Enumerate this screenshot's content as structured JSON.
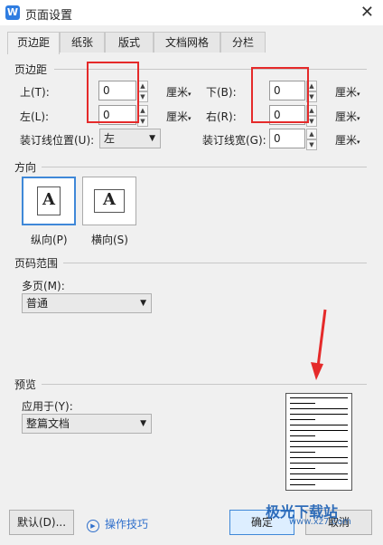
{
  "window": {
    "title": "页面设置",
    "close_glyph": "✕",
    "app_icon": "W"
  },
  "tabs": [
    "页边距",
    "纸张",
    "版式",
    "文档网格",
    "分栏"
  ],
  "margins": {
    "section": "页边距",
    "top": {
      "label": "上(T):",
      "value": "0",
      "unit": "厘米"
    },
    "bottom": {
      "label": "下(B):",
      "value": "0",
      "unit": "厘米"
    },
    "left": {
      "label": "左(L):",
      "value": "0",
      "unit": "厘米"
    },
    "right": {
      "label": "右(R):",
      "value": "0",
      "unit": "厘米"
    },
    "gutter_pos": {
      "label": "装订线位置(U):",
      "value": "左"
    },
    "gutter_width": {
      "label": "装订线宽(G):",
      "value": "0",
      "unit": "厘米"
    }
  },
  "orientation": {
    "section": "方向",
    "portrait": "纵向(P)",
    "landscape": "横向(S)",
    "glyph": "A"
  },
  "page_range": {
    "section": "页码范围",
    "multi_label": "多页(M):",
    "multi_value": "普通"
  },
  "preview": {
    "section": "预览",
    "apply_label": "应用于(Y):",
    "apply_value": "整篇文档"
  },
  "footer": {
    "default": "默认(D)...",
    "tips": "操作技巧",
    "ok": "确定",
    "cancel": "取消"
  },
  "watermark": {
    "text": "极光下载站",
    "url": "www.xz7.com"
  },
  "colors": {
    "highlight": "#e52a2a",
    "accent": "#3f88d8"
  }
}
